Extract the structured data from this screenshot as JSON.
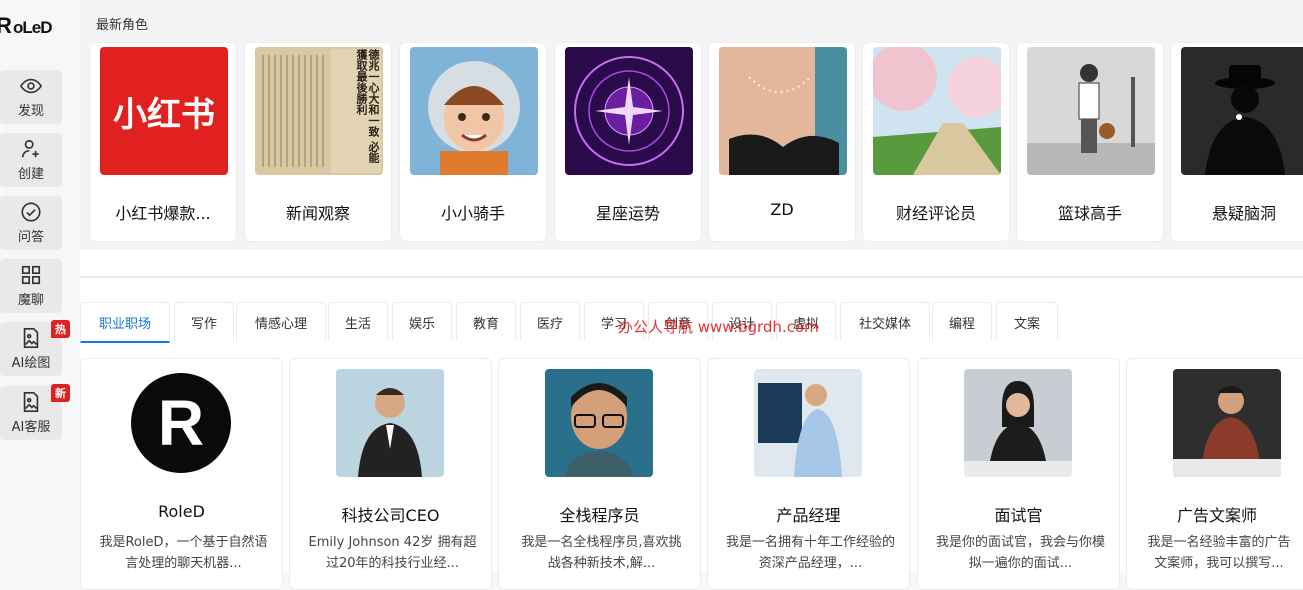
{
  "logo": {
    "text": "RoleD"
  },
  "sidebar": {
    "items": [
      {
        "label": "发现",
        "icon": "eye-icon"
      },
      {
        "label": "创建",
        "icon": "add-user-icon"
      },
      {
        "label": "问答",
        "icon": "check-circle-icon"
      },
      {
        "label": "魔聊",
        "icon": "grid-icon"
      },
      {
        "label": "AI绘图",
        "icon": "image-file-icon",
        "badge": "热"
      },
      {
        "label": "AI客服",
        "icon": "image-file-icon",
        "badge": "新"
      }
    ]
  },
  "latest": {
    "title": "最新角色",
    "roles": [
      {
        "name": "小红书爆款...",
        "logo_text": "小红书"
      },
      {
        "name": "新闻观察",
        "paper_text": "德兆一心大和一致 必能獲取最後勝利"
      },
      {
        "name": "小小骑手"
      },
      {
        "name": "星座运势"
      },
      {
        "name": "ZD"
      },
      {
        "name": "财经评论员"
      },
      {
        "name": "篮球高手"
      },
      {
        "name": "悬疑脑洞"
      }
    ]
  },
  "tabs": [
    {
      "label": "职业职场",
      "active": true
    },
    {
      "label": "写作"
    },
    {
      "label": "情感心理"
    },
    {
      "label": "生活"
    },
    {
      "label": "娱乐"
    },
    {
      "label": "教育"
    },
    {
      "label": "医疗"
    },
    {
      "label": "学习"
    },
    {
      "label": "创意"
    },
    {
      "label": "设计"
    },
    {
      "label": "虚拟"
    },
    {
      "label": "社交媒体"
    },
    {
      "label": "编程"
    },
    {
      "label": "文案"
    }
  ],
  "watermark": "办公人导航 www.bgrdh.com",
  "assistants": [
    {
      "name": "RoleD",
      "desc": "我是RoleD，一个基于自然语言处理的聊天机器..."
    },
    {
      "name": "科技公司CEO",
      "desc": "Emily Johnson 42岁 拥有超过20年的科技行业经..."
    },
    {
      "name": "全栈程序员",
      "desc": "我是一名全栈程序员,喜欢挑战各种新技术,解..."
    },
    {
      "name": "产品经理",
      "desc": "我是一名拥有十年工作经验的资深产品经理，..."
    },
    {
      "name": "面试官",
      "desc": "我是你的面试官，我会与你模拟一遍你的面试..."
    },
    {
      "name": "广告文案师",
      "desc": "我是一名经验丰富的广告文案师，我可以撰写..."
    }
  ],
  "colors": {
    "accent": "#1a73e8",
    "badge": "#e0211f",
    "xiaohongshu": "#e0211f"
  }
}
